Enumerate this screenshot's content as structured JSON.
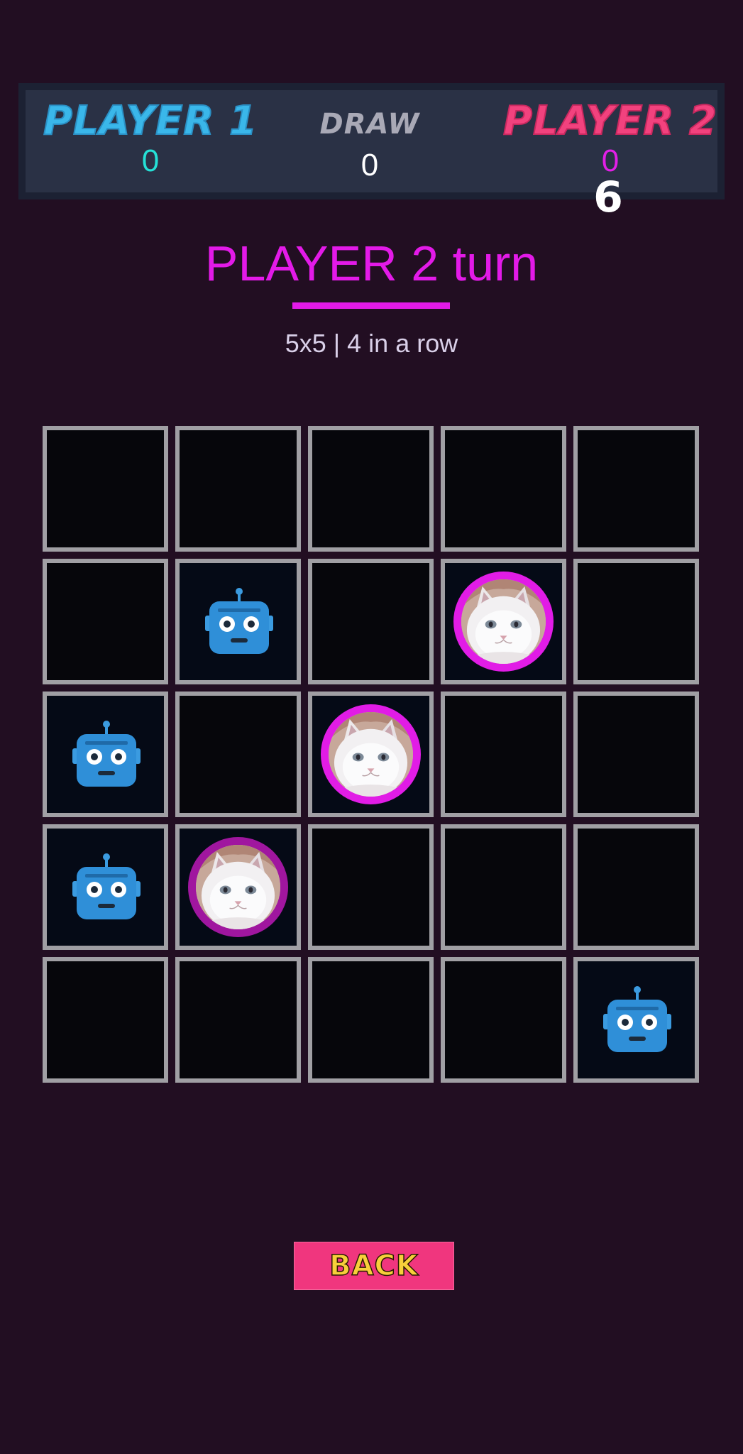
{
  "scoreboard": {
    "player1": {
      "label": "PLAYER 1",
      "score": "0"
    },
    "draw": {
      "label": "DRAW",
      "score": "0"
    },
    "player2": {
      "label": "PLAYER 2",
      "score": "0"
    }
  },
  "timer": "6",
  "status": {
    "turn_text": "PLAYER 2 turn",
    "mode_text": "5x5 | 4 in a row"
  },
  "board": {
    "size": 5,
    "cells": [
      [
        "",
        "",
        "",
        "",
        ""
      ],
      [
        "",
        "robot",
        "",
        "cat",
        ""
      ],
      [
        "robot",
        "",
        "cat",
        "",
        ""
      ],
      [
        "robot",
        "cat",
        "",
        "",
        ""
      ],
      [
        "",
        "",
        "",
        "",
        "robot"
      ]
    ],
    "pieces": {
      "robot": {
        "icon": "robot-icon",
        "owner": "PLAYER 1"
      },
      "cat": {
        "icon": "cat-avatar",
        "owner": "PLAYER 2"
      }
    }
  },
  "back_button": {
    "label": "BACK"
  },
  "colors": {
    "background": "#220e22",
    "player1": "#3ab7ea",
    "player2": "#f2427e",
    "turn": "#e31ae8",
    "button": "#f0367e",
    "button_text": "#f7cf3a"
  }
}
